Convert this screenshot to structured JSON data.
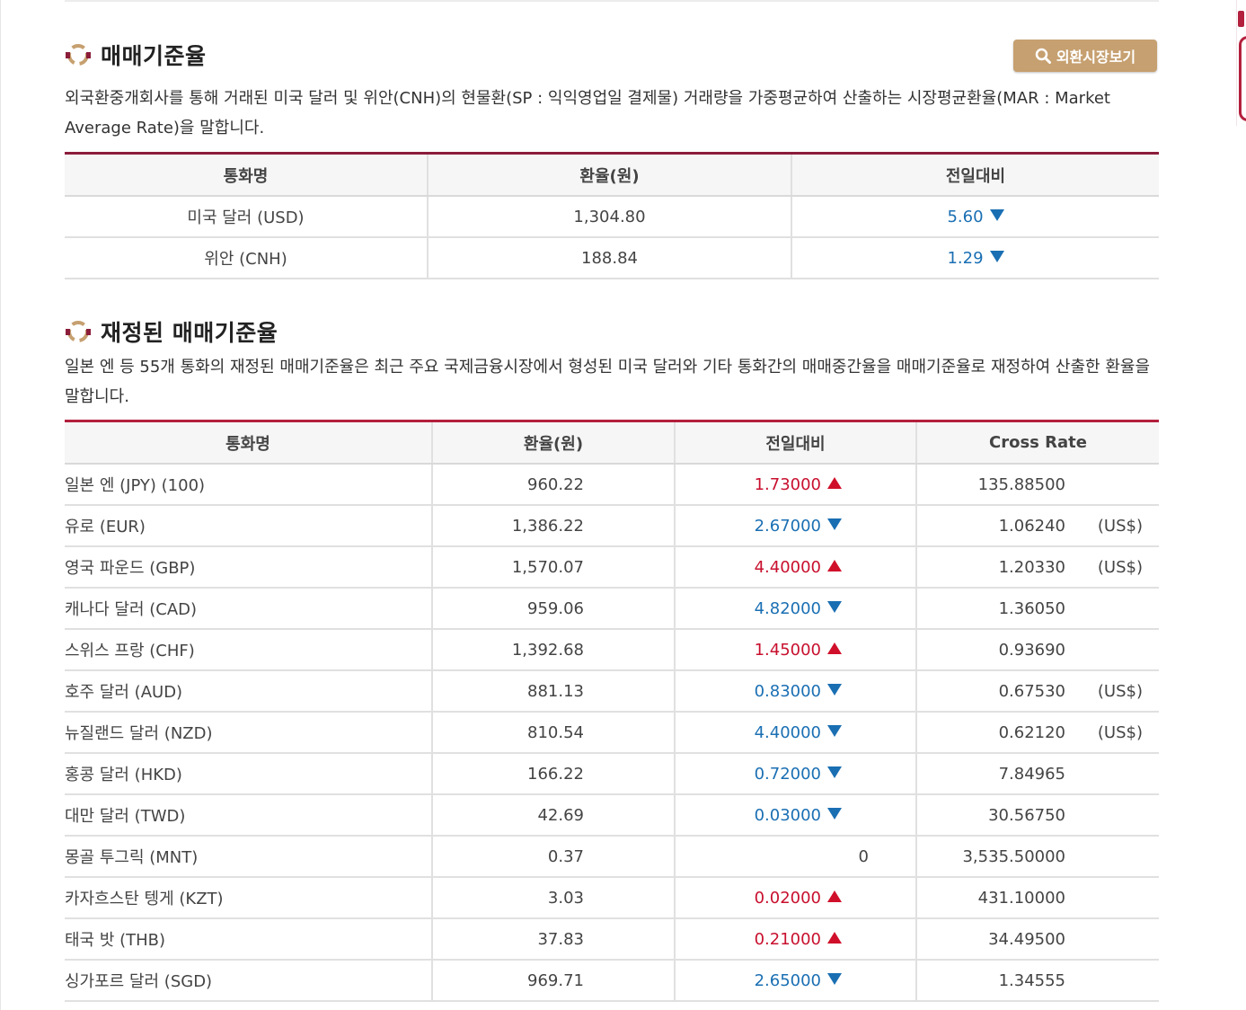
{
  "section1": {
    "title": "매매기준율",
    "button_label": "외환시장보기",
    "description": "외국환중개회사를 통해 거래된 미국 달러 및 위안(CNH)의 현물환(SP : 익익영업일 결제물) 거래량을 가중평균하여 산출하는 시장평균환율(MAR : Market Average Rate)을 말합니다.",
    "headers": [
      "통화명",
      "환율(원)",
      "전일대비"
    ],
    "rows": [
      {
        "name": "미국 달러 (USD)",
        "rate": "1,304.80",
        "change": "5.60",
        "direction": "down"
      },
      {
        "name": "위안 (CNH)",
        "rate": "188.84",
        "change": "1.29",
        "direction": "down"
      }
    ]
  },
  "section2": {
    "title": "재정된 매매기준율",
    "description": "일본 엔 등 55개 통화의 재정된 매매기준율은 최근 주요 국제금융시장에서 형성된 미국 달러와 기타 통화간의 매매중간율을 매매기준율로 재정하여 산출한 환율을 말합니다.",
    "headers": [
      "통화명",
      "환율(원)",
      "전일대비",
      "Cross Rate"
    ],
    "rows": [
      {
        "name": "일본 엔 (JPY) (100)",
        "rate": "960.22",
        "change": "1.73000",
        "direction": "up",
        "cross": "135.88500",
        "unit": ""
      },
      {
        "name": "유로 (EUR)",
        "rate": "1,386.22",
        "change": "2.67000",
        "direction": "down",
        "cross": "1.06240",
        "unit": "(US$)"
      },
      {
        "name": "영국 파운드 (GBP)",
        "rate": "1,570.07",
        "change": "4.40000",
        "direction": "up",
        "cross": "1.20330",
        "unit": "(US$)"
      },
      {
        "name": "캐나다 달러 (CAD)",
        "rate": "959.06",
        "change": "4.82000",
        "direction": "down",
        "cross": "1.36050",
        "unit": ""
      },
      {
        "name": "스위스 프랑 (CHF)",
        "rate": "1,392.68",
        "change": "1.45000",
        "direction": "up",
        "cross": "0.93690",
        "unit": ""
      },
      {
        "name": "호주 달러 (AUD)",
        "rate": "881.13",
        "change": "0.83000",
        "direction": "down",
        "cross": "0.67530",
        "unit": "(US$)"
      },
      {
        "name": "뉴질랜드 달러 (NZD)",
        "rate": "810.54",
        "change": "4.40000",
        "direction": "down",
        "cross": "0.62120",
        "unit": "(US$)"
      },
      {
        "name": "홍콩 달러 (HKD)",
        "rate": "166.22",
        "change": "0.72000",
        "direction": "down",
        "cross": "7.84965",
        "unit": ""
      },
      {
        "name": "대만 달러 (TWD)",
        "rate": "42.69",
        "change": "0.03000",
        "direction": "down",
        "cross": "30.56750",
        "unit": ""
      },
      {
        "name": "몽골 투그릭 (MNT)",
        "rate": "0.37",
        "change": "0",
        "direction": "none",
        "cross": "3,535.50000",
        "unit": ""
      },
      {
        "name": "카자흐스탄 텡게 (KZT)",
        "rate": "3.03",
        "change": "0.02000",
        "direction": "up",
        "cross": "431.10000",
        "unit": ""
      },
      {
        "name": "태국 밧 (THB)",
        "rate": "37.83",
        "change": "0.21000",
        "direction": "up",
        "cross": "34.49500",
        "unit": ""
      },
      {
        "name": "싱가포르 달러 (SGD)",
        "rate": "969.71",
        "change": "2.65000",
        "direction": "down",
        "cross": "1.34555",
        "unit": ""
      }
    ]
  },
  "colors": {
    "accent_border": "#8b1d3a",
    "button_bg": "#c6a070",
    "up": "#c8102e",
    "down": "#1a6fb3"
  },
  "icons": [
    "section-emblem-icon",
    "search-icon",
    "arrow-up-icon",
    "arrow-down-icon"
  ]
}
